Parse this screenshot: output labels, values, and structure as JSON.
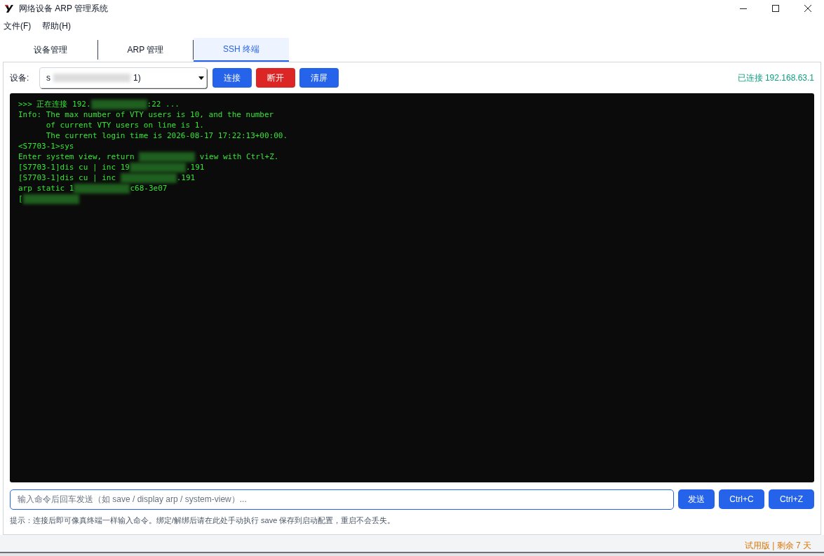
{
  "window": {
    "title": "网络设备 ARP 管理系统"
  },
  "menu": [
    "文件(F)",
    "帮助(H)"
  ],
  "tabs": [
    {
      "label": "设备管理",
      "selected": false
    },
    {
      "label": "ARP 管理",
      "selected": false
    },
    {
      "label": "SSH 终端",
      "selected": true
    }
  ],
  "toolbar": {
    "device_label": "设备:",
    "device_value": [
      {
        "kind": "text",
        "text": "s"
      },
      {
        "kind": "redacted"
      },
      {
        "kind": "text",
        "text": "1)"
      }
    ],
    "buttons": [
      {
        "label": "连接",
        "kind": "primary"
      },
      {
        "label": "断开",
        "kind": "danger"
      },
      {
        "label": "清屏",
        "kind": "primary"
      }
    ],
    "status": "已连接 192.168.63.1"
  },
  "terminal": {
    "lines": [
      [
        {
          "kind": "text",
          "text": ">>> 正在连接 192."
        },
        {
          "kind": "redacted"
        },
        {
          "kind": "text",
          "text": ":22 ..."
        }
      ],
      [
        {
          "kind": "text",
          "text": "Info: The max number of VTY users is 10, and the number"
        }
      ],
      [
        {
          "kind": "text",
          "text": "      of current VTY users on line is 1."
        }
      ],
      [
        {
          "kind": "text",
          "text": "      The current login time is 2026-08-17 17:22:13+00:00."
        }
      ],
      [
        {
          "kind": "text",
          "text": "<S7703-1>sys"
        }
      ],
      [
        {
          "kind": "text",
          "text": "Enter system view, return "
        },
        {
          "kind": "redacted"
        },
        {
          "kind": "text",
          "text": " view with Ctrl+Z."
        }
      ],
      [
        {
          "kind": "text",
          "text": "[S7703-1]dis cu | inc 19"
        },
        {
          "kind": "redacted"
        },
        {
          "kind": "text",
          "text": ".191"
        }
      ],
      [
        {
          "kind": "text",
          "text": "[S7703-1]dis cu | inc "
        },
        {
          "kind": "redacted"
        },
        {
          "kind": "text",
          "text": ".191"
        }
      ],
      [
        {
          "kind": "text",
          "text": "arp static 1"
        },
        {
          "kind": "redacted"
        },
        {
          "kind": "text",
          "text": "c68-3e07"
        }
      ],
      [
        {
          "kind": "text",
          "text": "["
        },
        {
          "kind": "redacted"
        }
      ]
    ]
  },
  "command": {
    "placeholder": "输入命令后回车发送（如 save / display arp / system-view）...",
    "buttons": [
      "发送",
      "Ctrl+C",
      "Ctrl+Z"
    ]
  },
  "hint": "提示：连接后即可像真终端一样输入命令。绑定/解绑后请在此处手动执行 save 保存到启动配置，重启不会丢失。",
  "status_bar": "试用版 | 剩余 7 天"
}
